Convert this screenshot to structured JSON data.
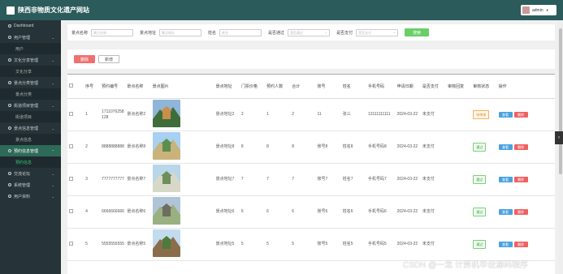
{
  "app": {
    "title": "陕西非物质文化遗产网站",
    "user": "admin"
  },
  "sidebar": {
    "items": [
      {
        "label": "Dashboard",
        "sub": null
      },
      {
        "label": "用户管理",
        "sub": "用户"
      },
      {
        "label": "文化分享管理",
        "sub": "文化分享"
      },
      {
        "label": "景点分类管理",
        "sub": "景点分类"
      },
      {
        "label": "街道项目管理",
        "sub": "街道项目"
      },
      {
        "label": "景点信息管理",
        "sub": "景点信息"
      },
      {
        "label": "预约信息管理",
        "sub": "预约信息"
      },
      {
        "label": "交流论坛",
        "sub": null
      },
      {
        "label": "系统管理",
        "sub": null
      },
      {
        "label": "用户资料",
        "sub": null
      }
    ]
  },
  "search": {
    "fields": [
      {
        "label": "景点名称",
        "placeholder": "景点名称",
        "type": "input"
      },
      {
        "label": "景点地址",
        "placeholder": "景点地址",
        "type": "input"
      },
      {
        "label": "姓名",
        "placeholder": "姓名",
        "type": "input"
      },
      {
        "label": "是否通过",
        "placeholder": "是否通过",
        "type": "select"
      },
      {
        "label": "是否支付",
        "placeholder": "是否支付",
        "type": "select"
      }
    ],
    "button": "搜索"
  },
  "actions": {
    "delete": "删除",
    "add": "新增"
  },
  "table": {
    "headers": [
      "",
      "序号",
      "预约编号",
      "景点名称",
      "景点图片",
      "景点地址",
      "门票价格",
      "预约人数",
      "合计",
      "账号",
      "姓名",
      "手机号码",
      "申请日期",
      "是否支付",
      "审核回复",
      "审核状态",
      "操作"
    ],
    "view_label": "查看",
    "delete_label": "删除",
    "rows": [
      {
        "no": "1",
        "code": "1711076258128",
        "name": "景点名称2",
        "addr": "景点地址2",
        "price": "2",
        "people": "1",
        "total": "2",
        "account": "11",
        "person": "张三",
        "phone": "13111111111",
        "date": "2024-03-22",
        "paid": "未支付",
        "reply": "",
        "status": "待审核"
      },
      {
        "no": "2",
        "code": "8888888888",
        "name": "景点名称8",
        "addr": "景点地址8",
        "price": "8",
        "people": "8",
        "total": "8",
        "account": "账号8",
        "person": "姓名8",
        "phone": "手机号码8",
        "date": "2024-03-22",
        "paid": "未支付",
        "reply": "",
        "status": "通过"
      },
      {
        "no": "3",
        "code": "7777777777",
        "name": "景点名称7",
        "addr": "景点地址7",
        "price": "7",
        "people": "7",
        "total": "7",
        "account": "账号7",
        "person": "姓名7",
        "phone": "手机号码7",
        "date": "2024-03-22",
        "paid": "未支付",
        "reply": "",
        "status": "通过"
      },
      {
        "no": "4",
        "code": "6666666666",
        "name": "景点名称6",
        "addr": "景点地址6",
        "price": "6",
        "people": "6",
        "total": "6",
        "account": "账号6",
        "person": "姓名6",
        "phone": "手机号码6",
        "date": "2024-03-22",
        "paid": "未支付",
        "reply": "",
        "status": "通过"
      },
      {
        "no": "5",
        "code": "5555555555",
        "name": "景点名称5",
        "addr": "景点地址5",
        "price": "5",
        "people": "5",
        "total": "5",
        "account": "账号5",
        "person": "姓名5",
        "phone": "手机号码5",
        "date": "2024-03-22",
        "paid": "未支付",
        "reply": "",
        "status": "通过"
      }
    ]
  },
  "watermark": "CSDN @一念 计算机毕设源码程序",
  "colors": {
    "header": "#2b5b5b",
    "sidebar": "#263338",
    "accent": "#6bcf67",
    "danger": "#f06060",
    "info": "#4aa3df"
  }
}
